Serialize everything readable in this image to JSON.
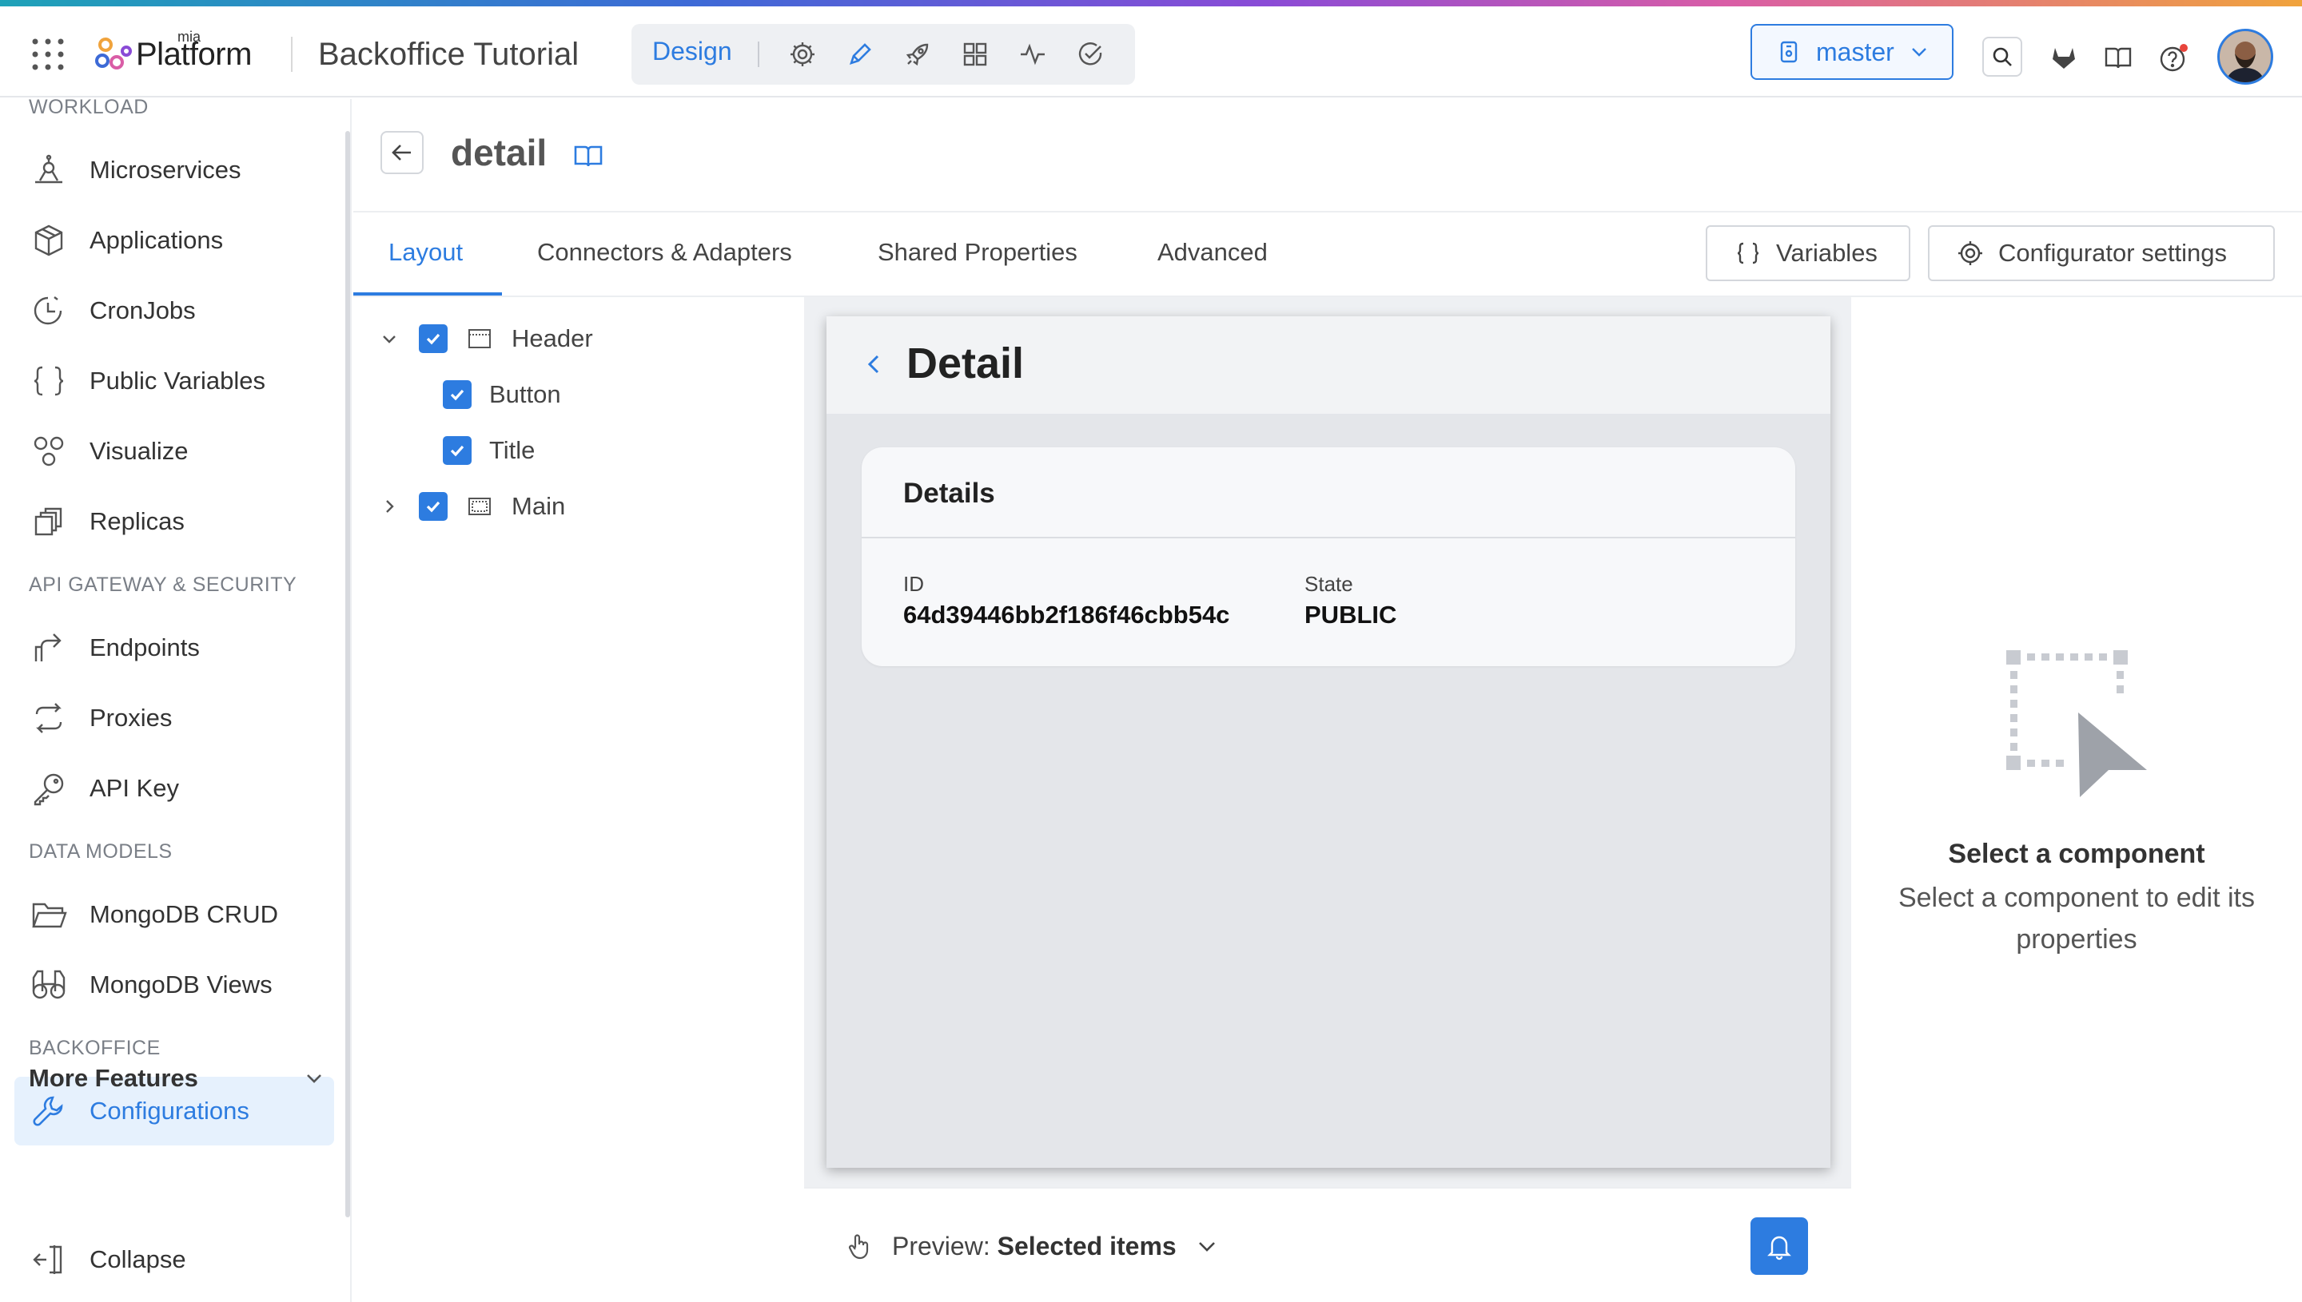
{
  "header": {
    "logo_small": "mia",
    "logo_text": "Platform",
    "project_name": "Backoffice Tutorial",
    "nav_active": "Design",
    "nav_icons": [
      "gear-icon",
      "pencil-icon",
      "rocket-icon",
      "grid-icon",
      "activity-icon",
      "check-circle-icon"
    ],
    "branch": "master",
    "right_icons": [
      "search-icon",
      "gitlab-icon",
      "book-icon",
      "help-icon",
      "avatar"
    ]
  },
  "sidebar": {
    "sections": [
      {
        "title": "WORKLOAD",
        "items": [
          {
            "label": "Microservices",
            "icon": "microservices-icon"
          },
          {
            "label": "Applications",
            "icon": "box-icon"
          },
          {
            "label": "CronJobs",
            "icon": "clock-icon"
          },
          {
            "label": "Public Variables",
            "icon": "braces-icon"
          },
          {
            "label": "Visualize",
            "icon": "nodes-icon"
          },
          {
            "label": "Replicas",
            "icon": "copies-icon"
          }
        ]
      },
      {
        "title": "API GATEWAY & SECURITY",
        "items": [
          {
            "label": "Endpoints",
            "icon": "share-icon"
          },
          {
            "label": "Proxies",
            "icon": "swap-icon"
          },
          {
            "label": "API Key",
            "icon": "key-icon"
          }
        ]
      },
      {
        "title": "DATA MODELS",
        "items": [
          {
            "label": "MongoDB CRUD",
            "icon": "folder-icon"
          },
          {
            "label": "MongoDB Views",
            "icon": "binoculars-icon"
          }
        ]
      },
      {
        "title": "BACKOFFICE",
        "items": [
          {
            "label": "Configurations",
            "icon": "wrench-icon",
            "active": true
          }
        ]
      }
    ],
    "more_features": "More Features",
    "collapse": "Collapse"
  },
  "page": {
    "title": "detail",
    "tabs": [
      {
        "label": "Layout",
        "active": true
      },
      {
        "label": "Connectors & Adapters"
      },
      {
        "label": "Shared Properties"
      },
      {
        "label": "Advanced"
      }
    ],
    "variables_btn": "Variables",
    "configurator_btn": "Configurator settings"
  },
  "tree": [
    {
      "label": "Header",
      "checked": true,
      "expanded": true,
      "icon": "header-layout-icon"
    },
    {
      "label": "Button",
      "checked": true
    },
    {
      "label": "Title",
      "checked": true
    },
    {
      "label": "Main",
      "checked": true,
      "expanded": false,
      "icon": "main-layout-icon"
    }
  ],
  "preview": {
    "title": "Detail",
    "card_title": "Details",
    "fields": [
      {
        "label": "ID",
        "value": "64d39446bb2f186f46cbb54c"
      },
      {
        "label": "State",
        "value": "PUBLIC"
      }
    ],
    "footer_prefix": "Preview:",
    "footer_value": "Selected items"
  },
  "properties_panel": {
    "empty_title": "Select a component",
    "empty_desc": "Select a component to edit its properties"
  },
  "colors": {
    "accent": "#2d7ce0",
    "active_bg": "#e6f1fd"
  }
}
